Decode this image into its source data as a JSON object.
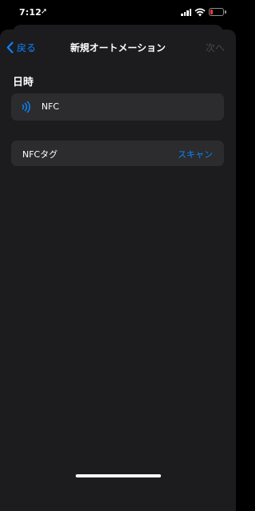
{
  "status_bar": {
    "time": "7:12",
    "location_icon": "location-arrow-icon",
    "battery_color": "#ff3b30"
  },
  "nav": {
    "back_label": "戻る",
    "title": "新規オートメーション",
    "next_label": "次へ"
  },
  "section": {
    "header": "日時"
  },
  "trigger": {
    "icon": "nfc-icon",
    "label": "NFC"
  },
  "tag_row": {
    "label": "NFCタグ",
    "action": "スキャン"
  },
  "colors": {
    "accent": "#0a84ff",
    "disabled": "#48484a",
    "card": "#2c2c2e",
    "sheet": "#1c1c1e"
  }
}
